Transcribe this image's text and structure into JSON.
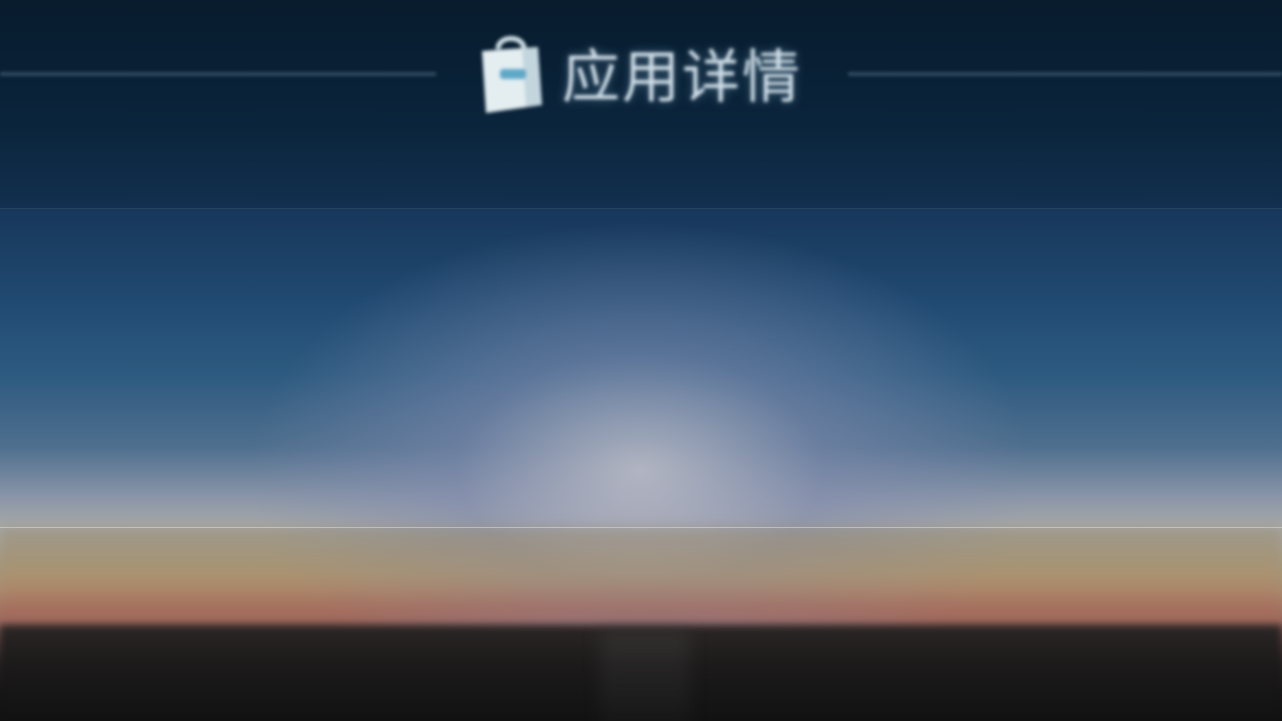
{
  "header": {
    "title": "应用详情",
    "icon": "shopping-bag-icon"
  },
  "colors": {
    "title_text": "#cfdde6",
    "sky_top": "#0a1f33",
    "sky_mid": "#2d5a80",
    "horizon_glow": "#a7a9a8",
    "sunset": "#9a6b60",
    "ground": "#111111"
  }
}
